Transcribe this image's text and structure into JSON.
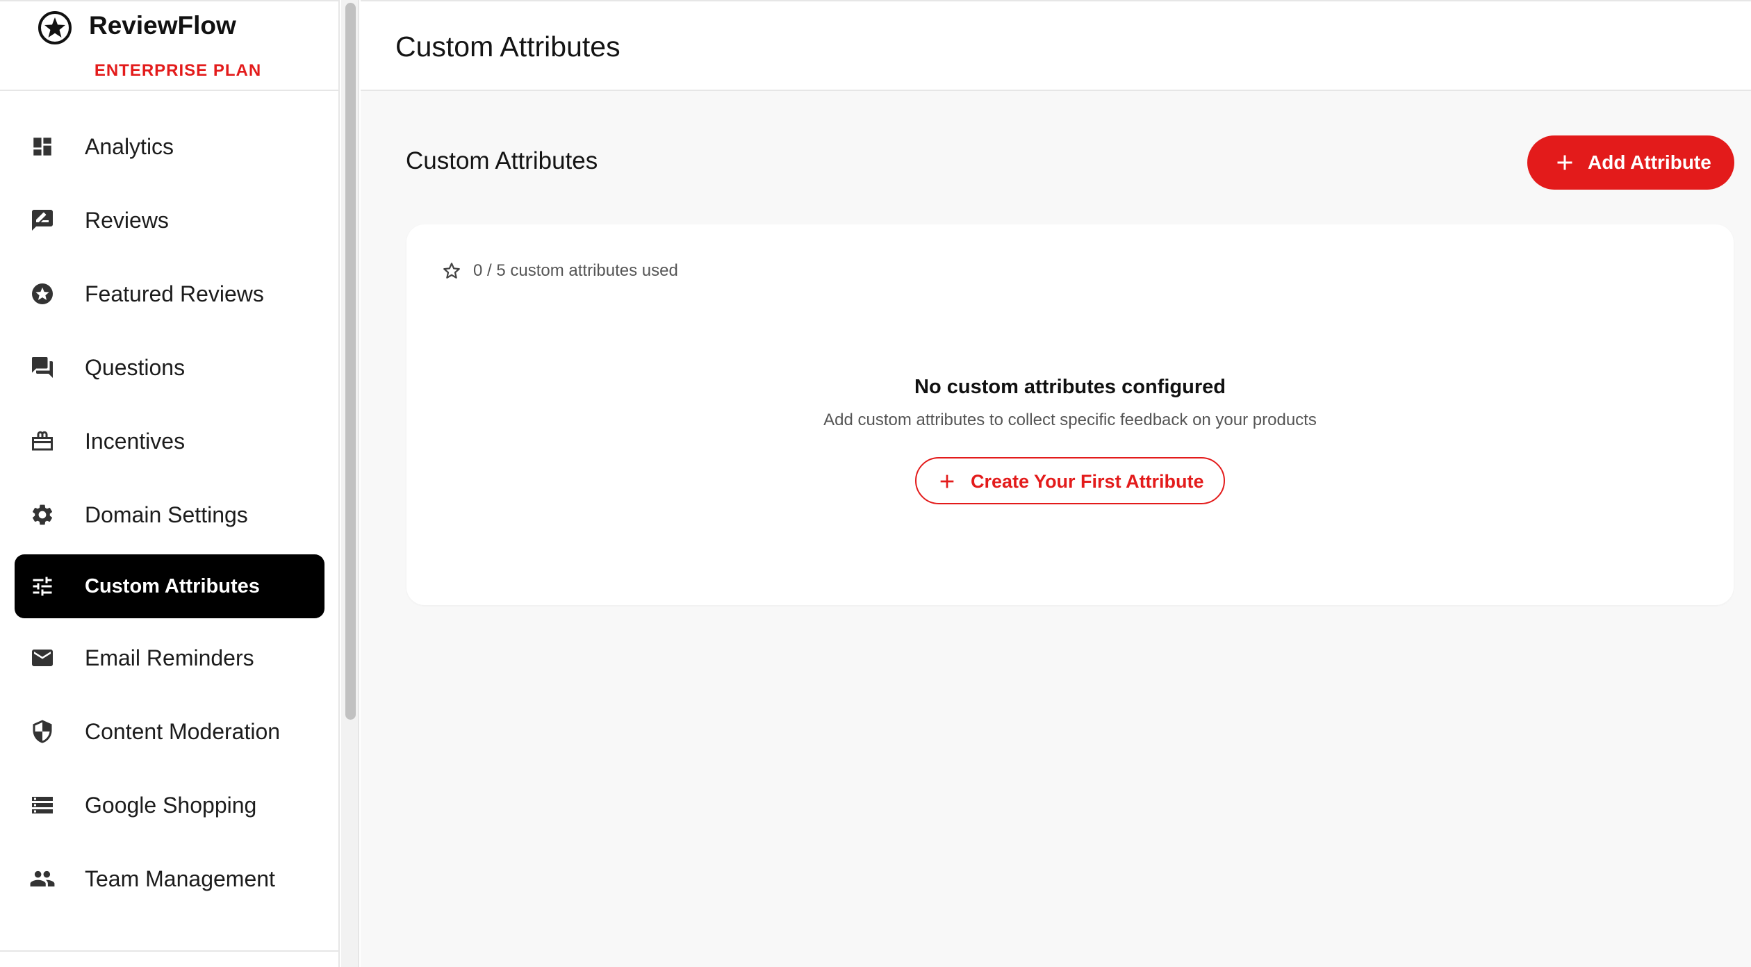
{
  "brand": {
    "name": "ReviewFlow",
    "plan": "ENTERPRISE PLAN"
  },
  "sidebar": {
    "items": [
      {
        "label": "Analytics",
        "icon": "dashboard-icon",
        "active": false
      },
      {
        "label": "Reviews",
        "icon": "rate-review-icon",
        "active": false
      },
      {
        "label": "Featured Reviews",
        "icon": "star-circle-icon",
        "active": false
      },
      {
        "label": "Questions",
        "icon": "forum-icon",
        "active": false
      },
      {
        "label": "Incentives",
        "icon": "gift-icon",
        "active": false
      },
      {
        "label": "Domain Settings",
        "icon": "gear-icon",
        "active": false
      },
      {
        "label": "Custom Attributes",
        "icon": "tune-icon",
        "active": true
      },
      {
        "label": "Email Reminders",
        "icon": "mail-icon",
        "active": false
      },
      {
        "label": "Content Moderation",
        "icon": "shield-icon",
        "active": false
      },
      {
        "label": "Google Shopping",
        "icon": "storage-list-icon",
        "active": false
      },
      {
        "label": "Team Management",
        "icon": "people-icon",
        "active": false
      }
    ]
  },
  "header": {
    "title": "Custom Attributes"
  },
  "content": {
    "section_title": "Custom Attributes",
    "add_button_label": "Add Attribute",
    "usage_text": "0 / 5 custom attributes used",
    "empty_title": "No custom attributes configured",
    "empty_description": "Add custom attributes to collect specific feedback on your products",
    "create_button_label": "Create Your First Attribute"
  },
  "colors": {
    "accent": "#e31b1b",
    "active_nav_bg": "#000000",
    "main_bg": "#f8f8f8"
  }
}
